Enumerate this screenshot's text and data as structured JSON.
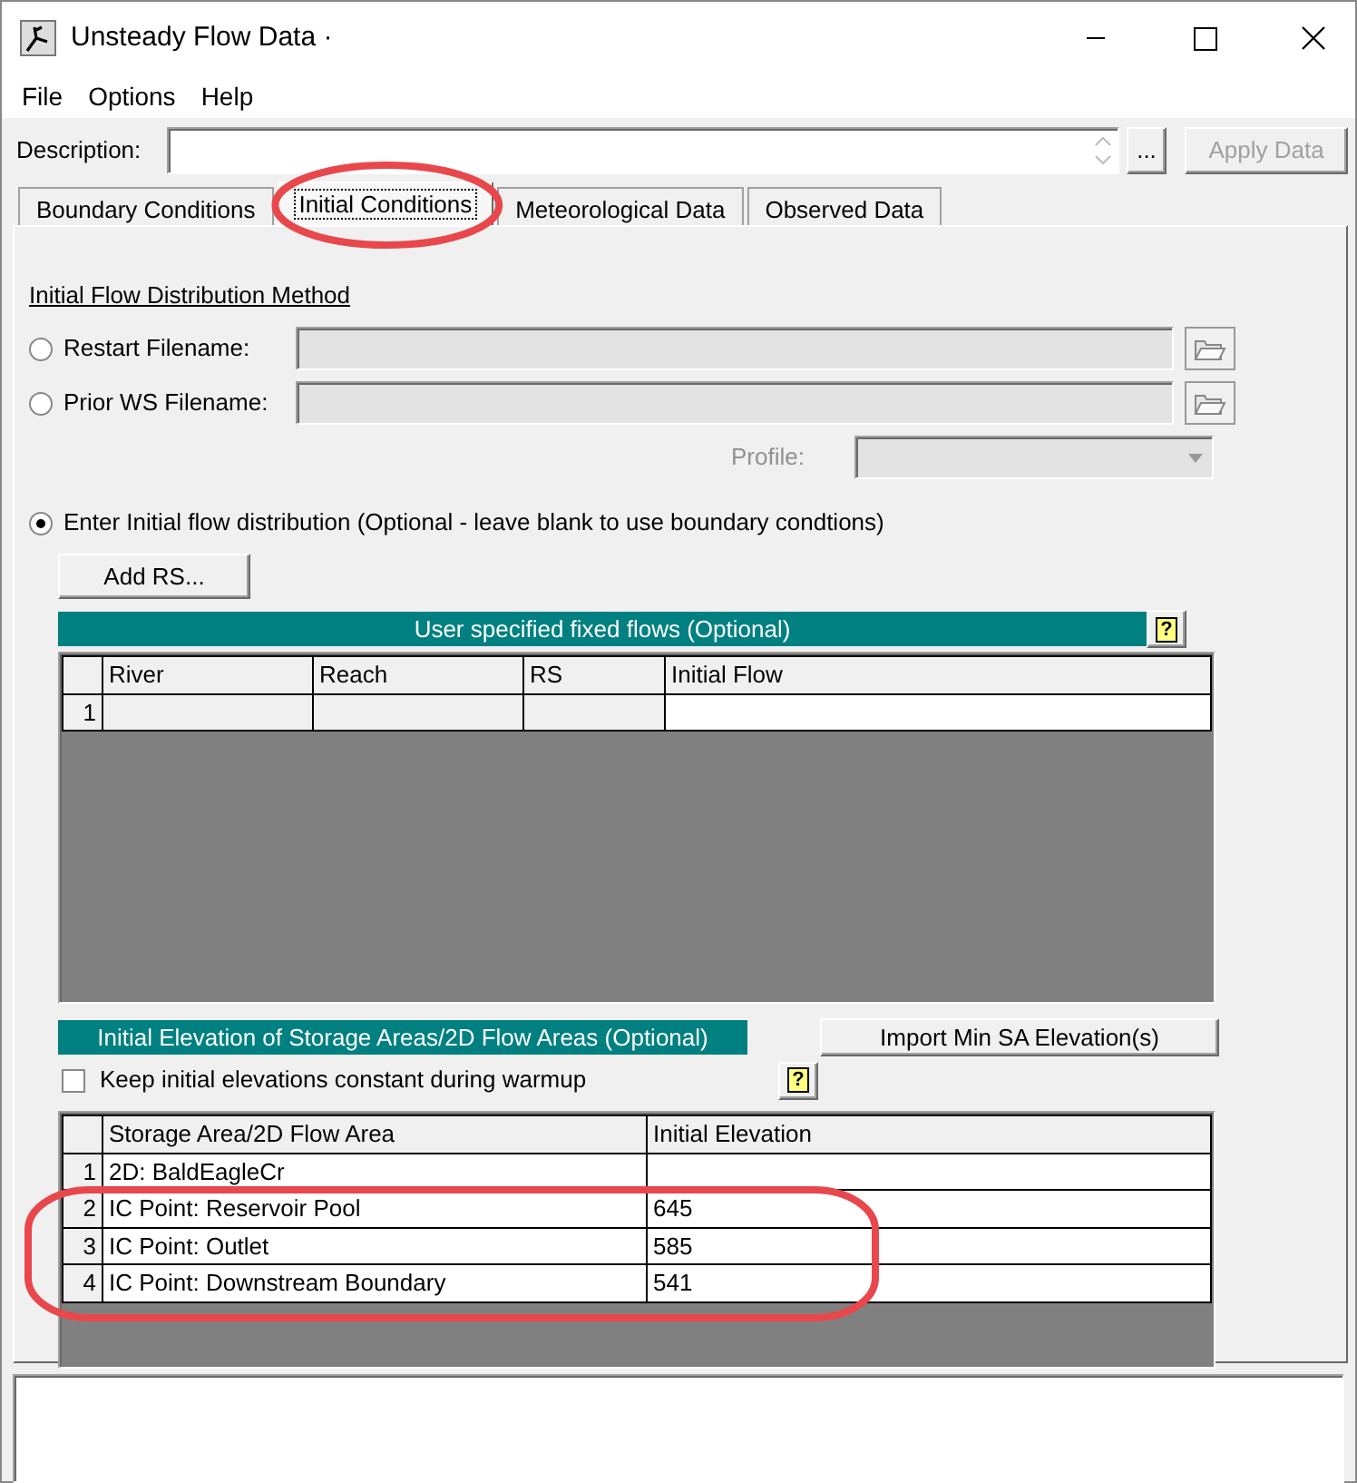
{
  "window": {
    "title": "Unsteady Flow Data ·"
  },
  "menu": [
    {
      "label": "File"
    },
    {
      "label": "Options"
    },
    {
      "label": "Help"
    }
  ],
  "description": {
    "label": "Description:"
  },
  "browse_button": "...",
  "apply_button": {
    "label": "Apply Data",
    "disabled": true
  },
  "tabs": [
    {
      "label": "Boundary Conditions",
      "selected": false
    },
    {
      "label": "Initial Conditions",
      "selected": true
    },
    {
      "label": "Meteorological Data",
      "selected": false
    },
    {
      "label": "Observed Data",
      "selected": false
    }
  ],
  "initial_flow": {
    "section_title": "Initial Flow Distribution Method",
    "options": [
      {
        "kind": "file",
        "label": "Restart Filename:",
        "selected": false
      },
      {
        "kind": "file",
        "label": "Prior WS Filename:",
        "selected": false
      },
      {
        "kind": "plain",
        "label": "Enter Initial flow distribution (Optional - leave blank to use boundary condtions)",
        "selected": true
      }
    ],
    "profile": {
      "label": "Profile:",
      "disabled": true
    }
  },
  "add_rs_button": "Add RS...",
  "fixed_flows": {
    "title": "User specified fixed flows (Optional)",
    "help": "?",
    "columns": [
      "River",
      "Reach",
      "RS",
      "Initial Flow"
    ],
    "rows": [
      {
        "number": "1"
      }
    ]
  },
  "storage_areas": {
    "title": "Initial Elevation of Storage Areas/2D Flow Areas (Optional)",
    "import_button": "Import Min SA Elevation(s)",
    "keep_constant": {
      "label": "Keep initial elevations constant during warmup",
      "checked": false
    },
    "help": "?",
    "columns": [
      "Storage Area/2D Flow Area",
      "Initial Elevation"
    ],
    "rows": [
      {
        "number": "1",
        "area": "2D: BaldEagleCr"
      },
      {
        "number": "2",
        "area": "IC Point: Reservoir Pool",
        "elevation": "645"
      },
      {
        "number": "3",
        "area": "IC Point: Outlet",
        "elevation": "585"
      },
      {
        "number": "4",
        "area": "IC Point: Downstream Boundary",
        "elevation": "541"
      }
    ]
  },
  "annotations": [
    {
      "kind": "ellipse"
    },
    {
      "kind": "oval"
    }
  ]
}
